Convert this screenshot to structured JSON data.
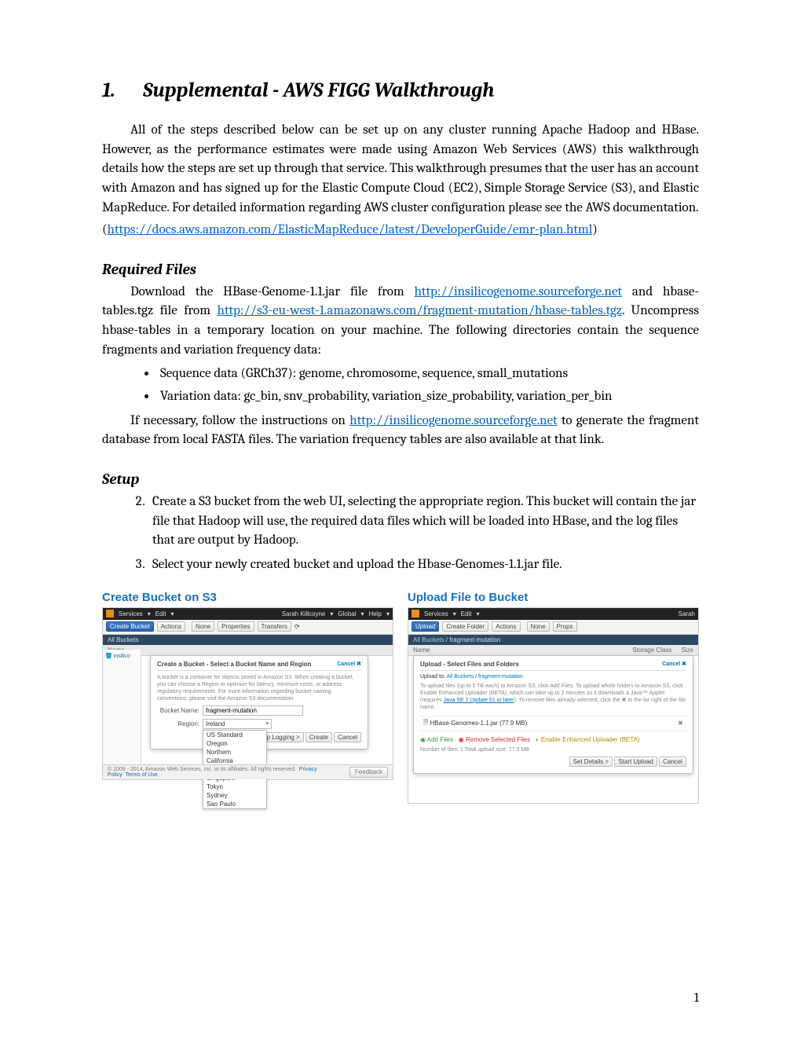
{
  "heading": {
    "number": "1.",
    "title": "Supplemental - AWS FIGG Walkthrough"
  },
  "intro": {
    "p1a": "All of the steps described below can be set up on any cluster running Apache Hadoop and HBase.  However, as the performance estimates were made using Amazon Web Services (AWS) this walkthrough details how the steps are set up through that service.  This walkthrough presumes that the user has an account with Amazon and has signed up for the Elastic Compute Cloud (EC2), Simple Storage Service (S3), and Elastic MapReduce.  For detailed information regarding AWS cluster configuration please see the AWS documentation.",
    "p1b_pre": "(",
    "p1b_link": "https://docs.aws.amazon.com/ElasticMapReduce/latest/DeveloperGuide/emr-plan.html",
    "p1b_post": ")"
  },
  "required_files": {
    "heading": "Required Files",
    "p1_a": "Download the HBase-Genome-1.1.jar file from ",
    "p1_link1": "http://insilicogenome.sourceforge.net",
    "p1_b": " and hbase-tables.tgz file from ",
    "p1_link2": "http://s3-eu-west-1.amazonaws.com/fragment-mutation/hbase-tables.tgz",
    "p1_c": ". Uncompress hbase-tables in a temporary location on your machine.  The following directories contain the sequence fragments and variation frequency data:",
    "bullet1": "Sequence data (GRCh37):  genome, chromosome, sequence, small_mutations",
    "bullet2": "Variation data: gc_bin, snv_probability, variation_size_probability, variation_per_bin",
    "p2_a": "If necessary, follow the instructions on ",
    "p2_link": "http://insilicogenome.sourceforge.net",
    "p2_b": " to generate the fragment database from local FASTA files.  The variation frequency tables are also available at that link."
  },
  "setup": {
    "heading": "Setup",
    "step2": "Create a S3 bucket from the web UI, selecting the appropriate region.  This bucket will contain the jar file that Hadoop will use, the required data files which will be loaded into HBase, and the log files that are output by Hadoop.",
    "step3": "Select your newly created bucket and upload the Hbase-Genomes-1.1.jar file."
  },
  "figA": {
    "title": "Create Bucket on S3",
    "top": {
      "services": "Services",
      "edit": "Edit",
      "user": "Sarah Killcoyne",
      "global": "Global",
      "help": "Help"
    },
    "tb": {
      "create": "Create Bucket",
      "actions": "Actions",
      "none": "None",
      "props": "Properties",
      "trans": "Transfers"
    },
    "crumb": "All Buckets",
    "col_name": "Name",
    "left_item": "insilico",
    "dlg": {
      "title": "Create a Bucket - Select a Bucket Name and Region",
      "cancel": "Cancel",
      "desc": "A bucket is a container for objects stored in Amazon S3. When creating a bucket, you can choose a Region to optimize for latency, minimize costs, or address regulatory requirements. For more information regarding bucket naming conventions, please visit the Amazon S3 documentation.",
      "bn_label": "Bucket Name:",
      "bn_value": "fragment-mutation",
      "reg_label": "Region:",
      "reg_value": "Ireland",
      "regions": [
        "US Standard",
        "Oregon",
        "Northern",
        "California",
        "Ireland",
        "Singapore",
        "Tokyo",
        "Sydney",
        "Sao Paulo"
      ],
      "btns": {
        "log": "Set Up Logging >",
        "create": "Create",
        "cancel": "Cancel"
      }
    },
    "footer": {
      "copy": "© 2009 - 2014, Amazon Web Services, Inc. or its affiliates. All rights reserved.",
      "privacy": "Privacy Policy",
      "terms": "Terms of Use",
      "fb": "Feedback"
    }
  },
  "figB": {
    "title": "Upload File to Bucket",
    "top": {
      "services": "Services",
      "edit": "Edit",
      "user": "Sarah"
    },
    "tb": {
      "upload": "Upload",
      "cf": "Create Folder",
      "actions": "Actions",
      "none": "None",
      "props": "Props"
    },
    "crumb_all": "All Buckets",
    "crumb_sep": " / ",
    "crumb_bk": "fragment-mutation",
    "col_name": "Name",
    "col_sc": "Storage Class",
    "col_size": "Size",
    "dlg": {
      "title": "Upload - Select Files and Folders",
      "cancel": "Cancel",
      "crumb_pre": "Upload to: ",
      "crumb_all": "All Buckets",
      "crumb_sep": " / ",
      "crumb_bk": "fragment-mutation",
      "desc_a": "To upload files (up to 5 TB each) to Amazon S3, click Add Files. To upload whole folders to Amazon S3, click Enable Enhanced Uploader (BETA), which can take up to 2 minutes as it downloads a Java™ Applet (requires ",
      "desc_link": "Java SE 7 Update 51 or later",
      "desc_b": "). To remove files already selected, click the ✖ to the far right of the file name.",
      "file": "HBase-Genomes-1.1.jar (77.9 MB)",
      "add": "Add Files",
      "remove": "Remove Selected Files",
      "enable": "Enable Enhanced Uploader (BETA)",
      "stats": "Number of files: 1   Total upload size: 77.9 MB",
      "btns": {
        "det": "Set Details >",
        "start": "Start Upload",
        "cancel": "Cancel"
      }
    }
  },
  "page_number": "1"
}
